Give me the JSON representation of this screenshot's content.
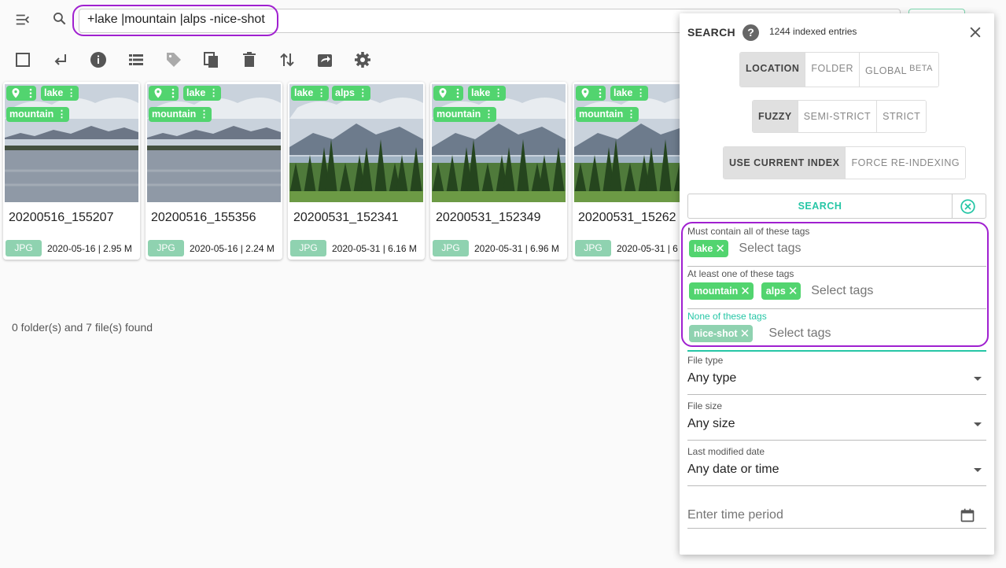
{
  "search": {
    "query": "+lake |mountain |alps -nice-shot"
  },
  "icons": {
    "menu": "menu-open-icon",
    "search": "magnify-icon",
    "toolbar": [
      "checkbox-blank-icon",
      "subdirectory-arrow-left-icon",
      "information-icon",
      "view-list-icon",
      "tag-icon",
      "copy-icon",
      "delete-icon",
      "sort-icon",
      "export-icon",
      "settings-icon"
    ]
  },
  "files": [
    {
      "title": "20200516_155207",
      "ext": "JPG",
      "meta": "2020-05-16 | 2.95 M",
      "tags": [
        "lake",
        "mountain"
      ],
      "geo": true,
      "scene": "lake"
    },
    {
      "title": "20200516_155356",
      "ext": "JPG",
      "meta": "2020-05-16 | 2.24 M",
      "tags": [
        "lake",
        "mountain"
      ],
      "geo": true,
      "scene": "lake"
    },
    {
      "title": "20200531_152341",
      "ext": "JPG",
      "meta": "2020-05-31 | 6.16 M",
      "tags": [
        "lake",
        "alps"
      ],
      "geo": false,
      "scene": "forest"
    },
    {
      "title": "20200531_152349",
      "ext": "JPG",
      "meta": "2020-05-31 | 6.96 M",
      "tags": [
        "lake",
        "mountain"
      ],
      "geo": true,
      "scene": "forest"
    },
    {
      "title": "20200531_15262",
      "ext": "JPG",
      "meta": "2020-05-31 | 6",
      "tags": [
        "lake",
        "mountain"
      ],
      "geo": true,
      "scene": "forest"
    }
  ],
  "found_text": "0 folder(s) and 7 file(s) found",
  "panel": {
    "title": "SEARCH",
    "help": "?",
    "indexed": "1244 indexed entries",
    "scope": [
      "LOCATION",
      "FOLDER",
      "GLOBAL"
    ],
    "scope_badge": "BETA",
    "mode": [
      "FUZZY",
      "SEMI-STRICT",
      "STRICT"
    ],
    "index": [
      "USE CURRENT INDEX",
      "FORCE RE-INDEXING"
    ],
    "search_button": "SEARCH",
    "must_label": "Must contain all of these tags",
    "must_tags": [
      "lake"
    ],
    "any_label": "At least one of these tags",
    "any_tags": [
      "mountain",
      "alps"
    ],
    "none_label": "None of these tags",
    "none_tags": [
      "nice-shot"
    ],
    "tag_placeholder": "Select tags",
    "file_type_label": "File type",
    "file_type": "Any type",
    "file_size_label": "File size",
    "file_size": "Any size",
    "modified_label": "Last modified date",
    "modified": "Any date or time",
    "time_placeholder": "Enter time period"
  },
  "colors": {
    "tag": "#52d46f",
    "accent": "#26c6a6",
    "highlight": "#a020d0",
    "ext_badge": "#8fd2b0"
  }
}
